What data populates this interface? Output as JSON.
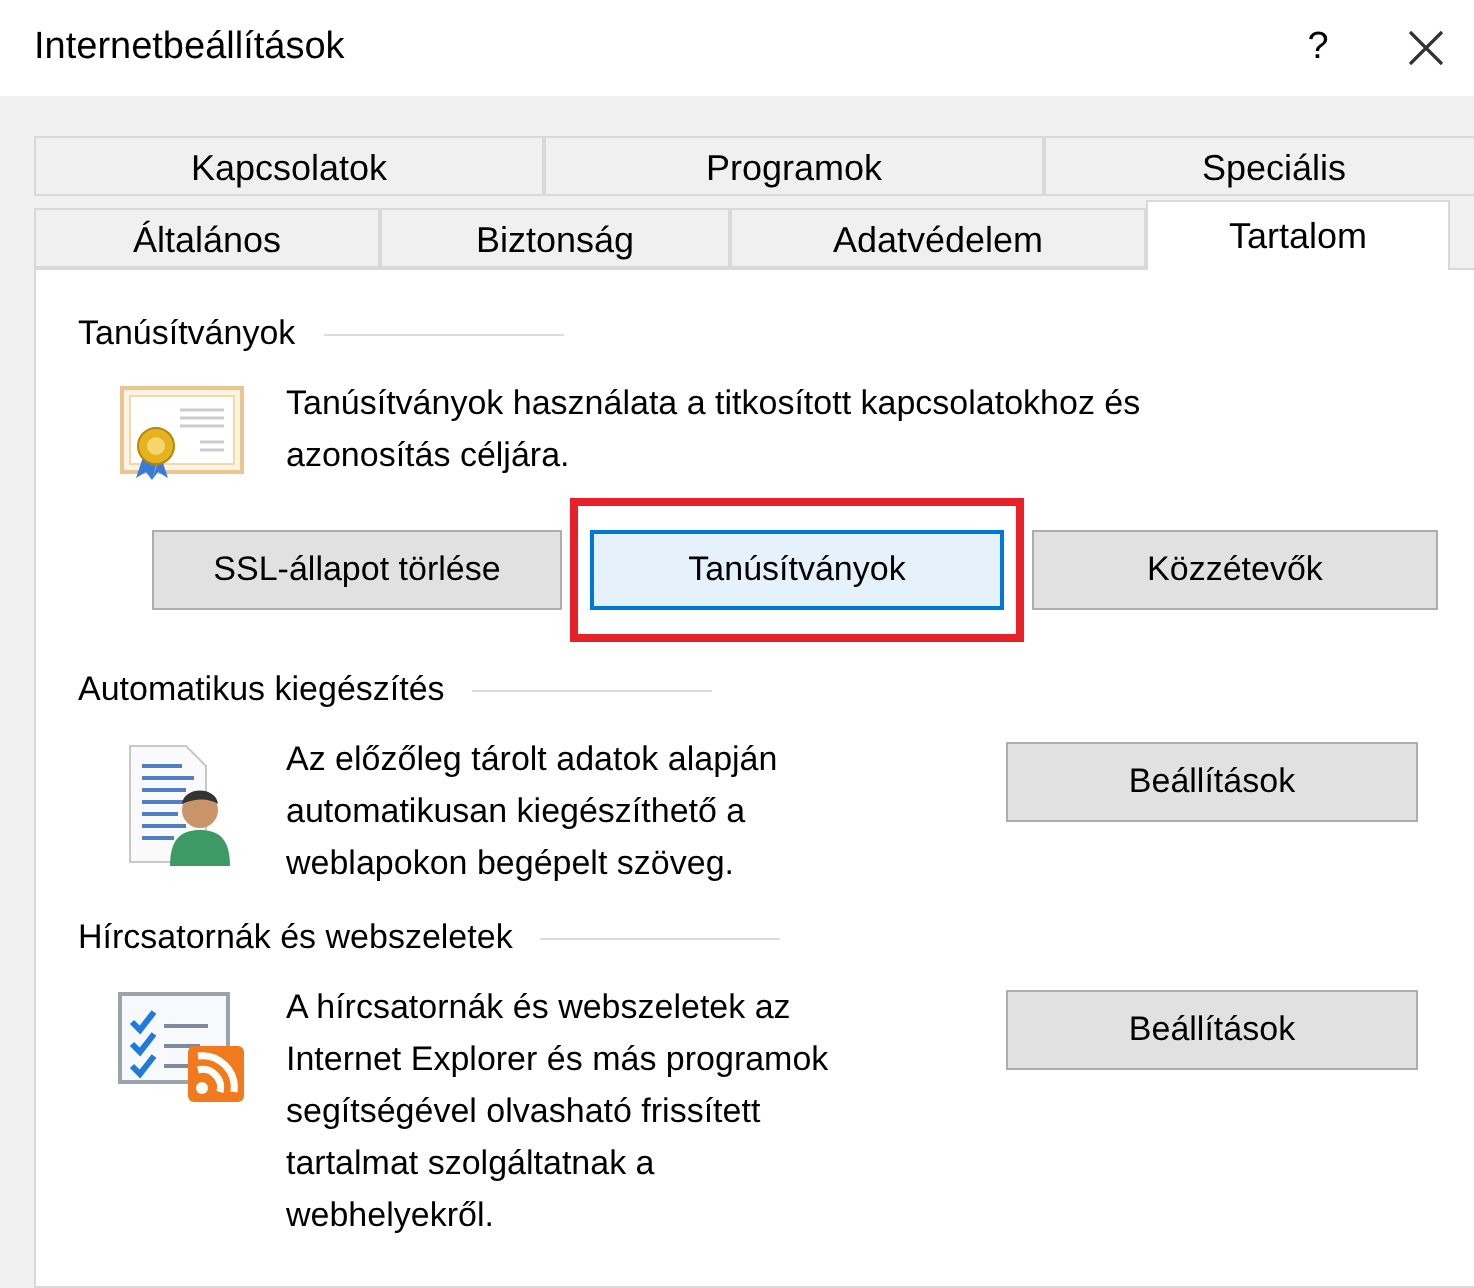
{
  "window": {
    "title": "Internetbeállítások",
    "help": "?"
  },
  "tab_rows": [
    [
      {
        "label": "Kapcsolatok",
        "selected": false
      },
      {
        "label": "Programok",
        "selected": false
      },
      {
        "label": "Speciális",
        "selected": false
      }
    ],
    [
      {
        "label": "Általános",
        "selected": false
      },
      {
        "label": "Biztonság",
        "selected": false
      },
      {
        "label": "Adatvédelem",
        "selected": false
      },
      {
        "label": "Tartalom",
        "selected": true
      }
    ]
  ],
  "sections": [
    {
      "kind": "buttons_below",
      "heading": "Tanúsítványok",
      "text": "Tanúsítványok használata a titkosított kapcsolatokhoz és\nazonosítás céljára.",
      "buttons": [
        {
          "label": "SSL-állapot törlése",
          "focused": false,
          "highlighted": false
        },
        {
          "label": "Tanúsítványok",
          "focused": true,
          "highlighted": true
        },
        {
          "label": "Közzétevők",
          "focused": false,
          "highlighted": false
        }
      ]
    },
    {
      "kind": "button_right",
      "heading": "Automatikus kiegészítés",
      "text": "Az előzőleg tárolt adatok alapján\nautomatikusan kiegészíthető a\nweblapokon begépelt szöveg.",
      "buttons": [
        {
          "label": "Beállítások",
          "focused": false,
          "highlighted": false
        }
      ]
    },
    {
      "kind": "button_right",
      "heading": "Hírcsatornák és webszeletek",
      "text": "A hírcsatornák és webszeletek az\nInternet Explorer és más programok\nsegítségével olvasható frissített\ntartalmat szolgáltatnak a\nwebhelyekről.",
      "buttons": [
        {
          "label": "Beállítások",
          "focused": false,
          "highlighted": false
        }
      ]
    }
  ]
}
